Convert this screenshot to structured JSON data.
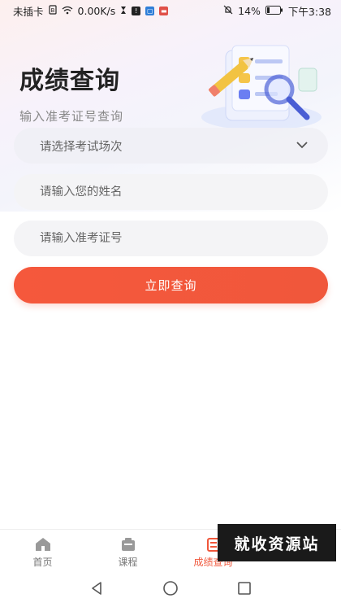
{
  "status_bar": {
    "carrier": "未插卡",
    "network_speed": "0.00K/s",
    "battery": "14%",
    "time": "下午3:38"
  },
  "header": {
    "title": "成绩查询",
    "subtitle": "输入准考证号查询"
  },
  "form": {
    "exam_select": {
      "placeholder": "请选择考试场次"
    },
    "name_input": {
      "placeholder": "请输入您的姓名"
    },
    "ticket_input": {
      "placeholder": "请输入准考证号"
    },
    "submit_label": "立即查询"
  },
  "tabbar": {
    "items": [
      {
        "label": "首页",
        "icon": "home-icon",
        "active": false
      },
      {
        "label": "课程",
        "icon": "course-icon",
        "active": false
      },
      {
        "label": "成绩查询",
        "icon": "score-query-icon",
        "active": true
      }
    ]
  },
  "watermark": {
    "text": "就收资源站"
  },
  "colors": {
    "accent": "#f0573b",
    "field_bg": "#f4f4f6",
    "title": "#222222"
  }
}
